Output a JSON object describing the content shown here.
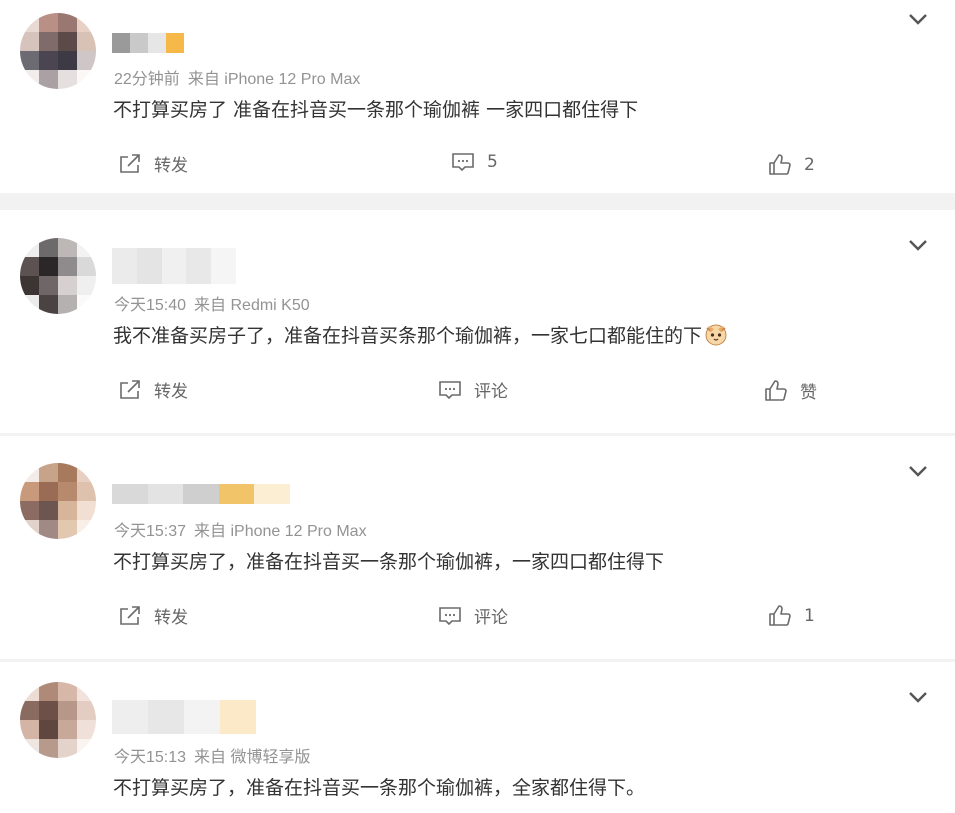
{
  "comments": [
    {
      "time": "22分钟前",
      "source": "来自 iPhone 12 Pro Max",
      "text": "不打算买房了 准备在抖音买一条那个瑜伽裤 一家四口都住得下",
      "repost_label": "转发",
      "comment_label": "5",
      "like_label": "2",
      "avatar_colors": [
        "#e8d9d3",
        "#b98f86",
        "#9a7770",
        "#e9d0c4",
        "#d6c3bc",
        "#7e6b6a",
        "#5c4a49",
        "#d8c2b6",
        "#6c6b73",
        "#4b4451",
        "#3d3a45",
        "#cfc6c8",
        "#f2ecea",
        "#a9a1a4",
        "#e5dfdf",
        "#fbf8f7"
      ],
      "name_colors": [
        "#9a9a9a",
        "#c9c9c9",
        "#e6e6e6",
        "#f7b84a"
      ]
    },
    {
      "time": "今天15:40",
      "source": "来自 Redmi K50",
      "text": "我不准备买房子了，准备在抖音买条那个瑜伽裤，一家七口都能住的下",
      "repost_label": "转发",
      "comment_label": "评论",
      "like_label": "赞",
      "avatar_colors": [
        "#eeeeee",
        "#6d6a6b",
        "#bdb7b6",
        "#f2f2f2",
        "#5b5251",
        "#2b2728",
        "#8f8a8c",
        "#d9d9d9",
        "#3c3534",
        "#6e6667",
        "#d6d1d0",
        "#efefef",
        "#ecebeb",
        "#4a4243",
        "#b5b1b1",
        "#fafafa"
      ],
      "name_colors": [
        "#ebebeb",
        "#e4e4e4",
        "#f0f0f0",
        "#e8e8e8",
        "#f5f5f5"
      ]
    },
    {
      "time": "今天15:37",
      "source": "来自 iPhone 12 Pro Max",
      "text": "不打算买房了，准备在抖音买一条那个瑜伽裤，一家四口都住得下",
      "repost_label": "转发",
      "comment_label": "评论",
      "like_label": "1",
      "avatar_colors": [
        "#f3ebe7",
        "#c7a38a",
        "#a87a5d",
        "#e7d0c1",
        "#c89a7b",
        "#9a6c55",
        "#b88a6d",
        "#dfc2ad",
        "#8c6b62",
        "#6e5650",
        "#d7b59a",
        "#f0dfd2",
        "#e2d2cc",
        "#a18a86",
        "#e3c8b0",
        "#f7efe8"
      ],
      "name_colors": [
        "#d9d9d9",
        "#e3e3e3",
        "#cfcfcf",
        "#f2c46a",
        "#fbeed2"
      ]
    },
    {
      "time": "今天15:13",
      "source": "来自 微博轻享版",
      "text": "不打算买房了，准备在抖音买一条那个瑜伽裤，全家都住得下。",
      "avatar_colors": [
        "#ecdcd3",
        "#b08a79",
        "#d7b7a7",
        "#f1e3dc",
        "#8a6b5f",
        "#6d5048",
        "#b7978a",
        "#e3cdc2",
        "#d4b4a5",
        "#5f463f",
        "#c8a898",
        "#efe1da",
        "#efe6e2",
        "#b89a8c",
        "#e4d3cb",
        "#faf4f1"
      ],
      "name_colors": [
        "#eeeeee",
        "#e7e7e7",
        "#f3f3f3",
        "#fbe9c8"
      ]
    }
  ]
}
